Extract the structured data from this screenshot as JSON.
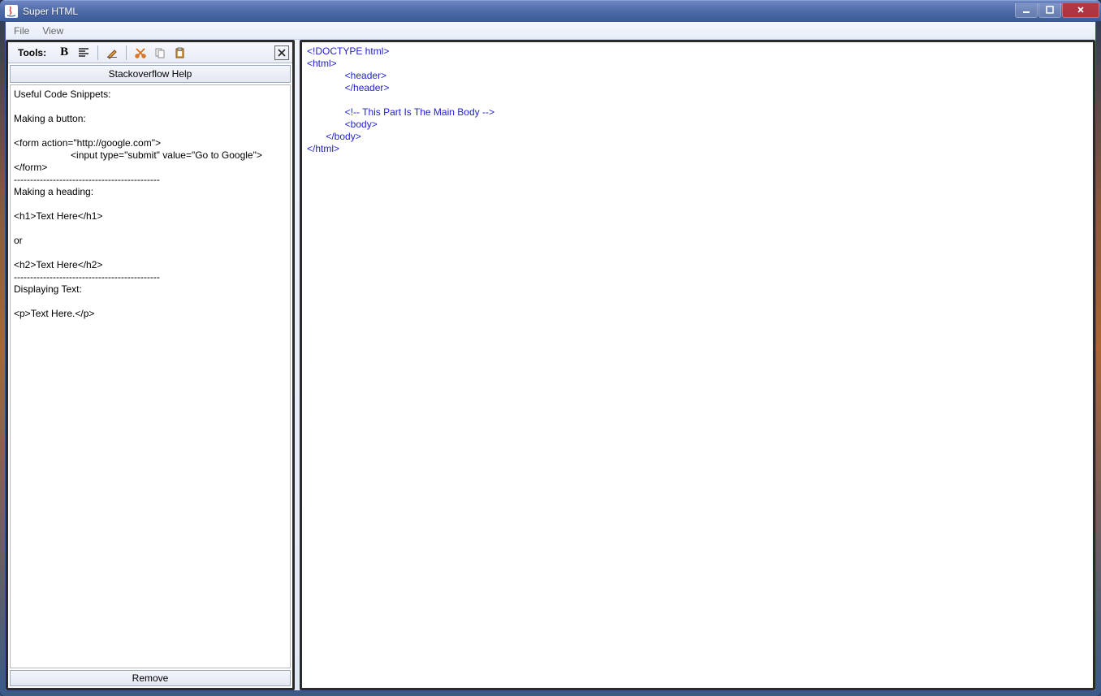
{
  "titlebar": {
    "title": "Super HTML"
  },
  "menubar": {
    "file": "File",
    "view": "View"
  },
  "toolbar": {
    "label": "Tools:"
  },
  "left": {
    "stackoverflow_btn": "Stackoverflow Help",
    "remove_btn": "Remove",
    "snippets_lines": [
      "Useful Code Snippets:",
      "",
      "Making a button:",
      "",
      "<form action=\"http://google.com\">",
      "                     <input type=\"submit\" value=\"Go to Google\">",
      "</form>",
      "---------------------------------------------",
      "Making a heading:",
      "",
      "<h1>Text Here</h1>",
      "",
      "or",
      "",
      "<h2>Text Here</h2>",
      "---------------------------------------------",
      "Displaying Text:",
      "",
      "<p>Text Here.</p>"
    ]
  },
  "editor": {
    "lines": [
      "<!DOCTYPE html>",
      "<html>",
      "              <header>",
      "              </header>",
      "",
      "              <!-- This Part Is The Main Body -->",
      "              <body>",
      "       </body>",
      "</html>"
    ]
  }
}
